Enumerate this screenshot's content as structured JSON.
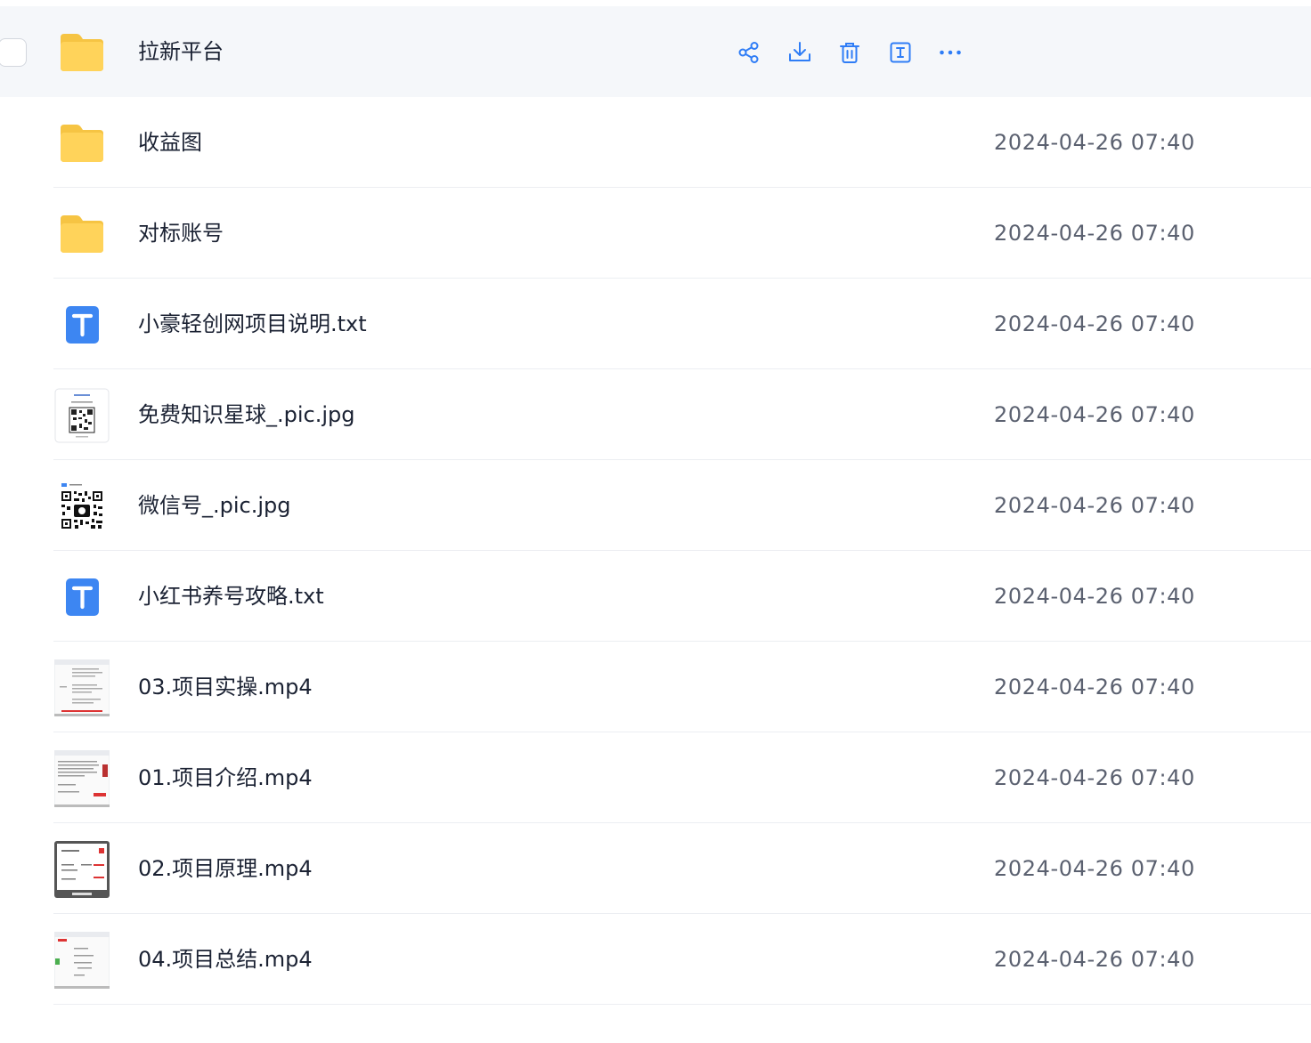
{
  "accent_color": "#2f7df6",
  "folder_color": "#ffd35a",
  "row_actions": {
    "share_icon": "share-icon",
    "download_icon": "download-icon",
    "delete_icon": "trash-icon",
    "rename_icon": "rename-icon",
    "more_icon": "more-icon"
  },
  "files": [
    {
      "name": "拉新平台",
      "type": "folder",
      "date": ""
    },
    {
      "name": "收益图",
      "type": "folder",
      "date": "2024-04-26 07:40"
    },
    {
      "name": "对标账号",
      "type": "folder",
      "date": "2024-04-26 07:40"
    },
    {
      "name": "小豪轻创网项目说明.txt",
      "type": "txt",
      "date": "2024-04-26 07:40"
    },
    {
      "name": "免费知识星球_.pic.jpg",
      "type": "image",
      "date": "2024-04-26 07:40"
    },
    {
      "name": "微信号_.pic.jpg",
      "type": "image",
      "date": "2024-04-26 07:40"
    },
    {
      "name": "小红书养号攻略.txt",
      "type": "txt",
      "date": "2024-04-26 07:40"
    },
    {
      "name": "03.项目实操.mp4",
      "type": "video",
      "date": "2024-04-26 07:40"
    },
    {
      "name": "01.项目介绍.mp4",
      "type": "video",
      "date": "2024-04-26 07:40"
    },
    {
      "name": "02.项目原理.mp4",
      "type": "video",
      "date": "2024-04-26 07:40"
    },
    {
      "name": "04.项目总结.mp4",
      "type": "video",
      "date": "2024-04-26 07:40"
    }
  ]
}
